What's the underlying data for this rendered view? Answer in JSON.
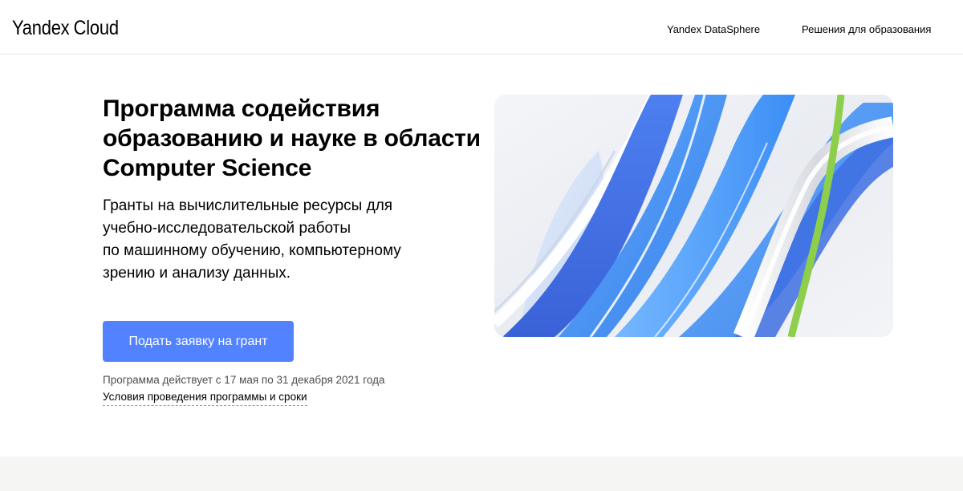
{
  "header": {
    "logo_part1": "Yandex",
    "logo_part2": "Cloud",
    "nav": {
      "datasphere": "Yandex DataSphere",
      "education": "Решения для образования"
    }
  },
  "hero": {
    "title": "Программа содействия образованию и науке в области Computer Science",
    "subtitle_lines": [
      "Гранты на вычислительные ресурсы для",
      "учебно-исследовательской работы",
      "по машинному обучению, компьютерному",
      "зрению и анализу данных."
    ],
    "cta_label": "Подать заявку на грант",
    "program_dates": "Программа действует с 17 мая по 31 декабря 2021 года",
    "terms_link": "Условия проведения программы и сроки"
  },
  "colors": {
    "accent": "#5282ff",
    "ribbon_blue": "#3f8cf2",
    "ribbon_deep_blue": "#4a6fe0",
    "ribbon_green": "#8dcf4a",
    "bottom_band": "#f5f5f3"
  }
}
